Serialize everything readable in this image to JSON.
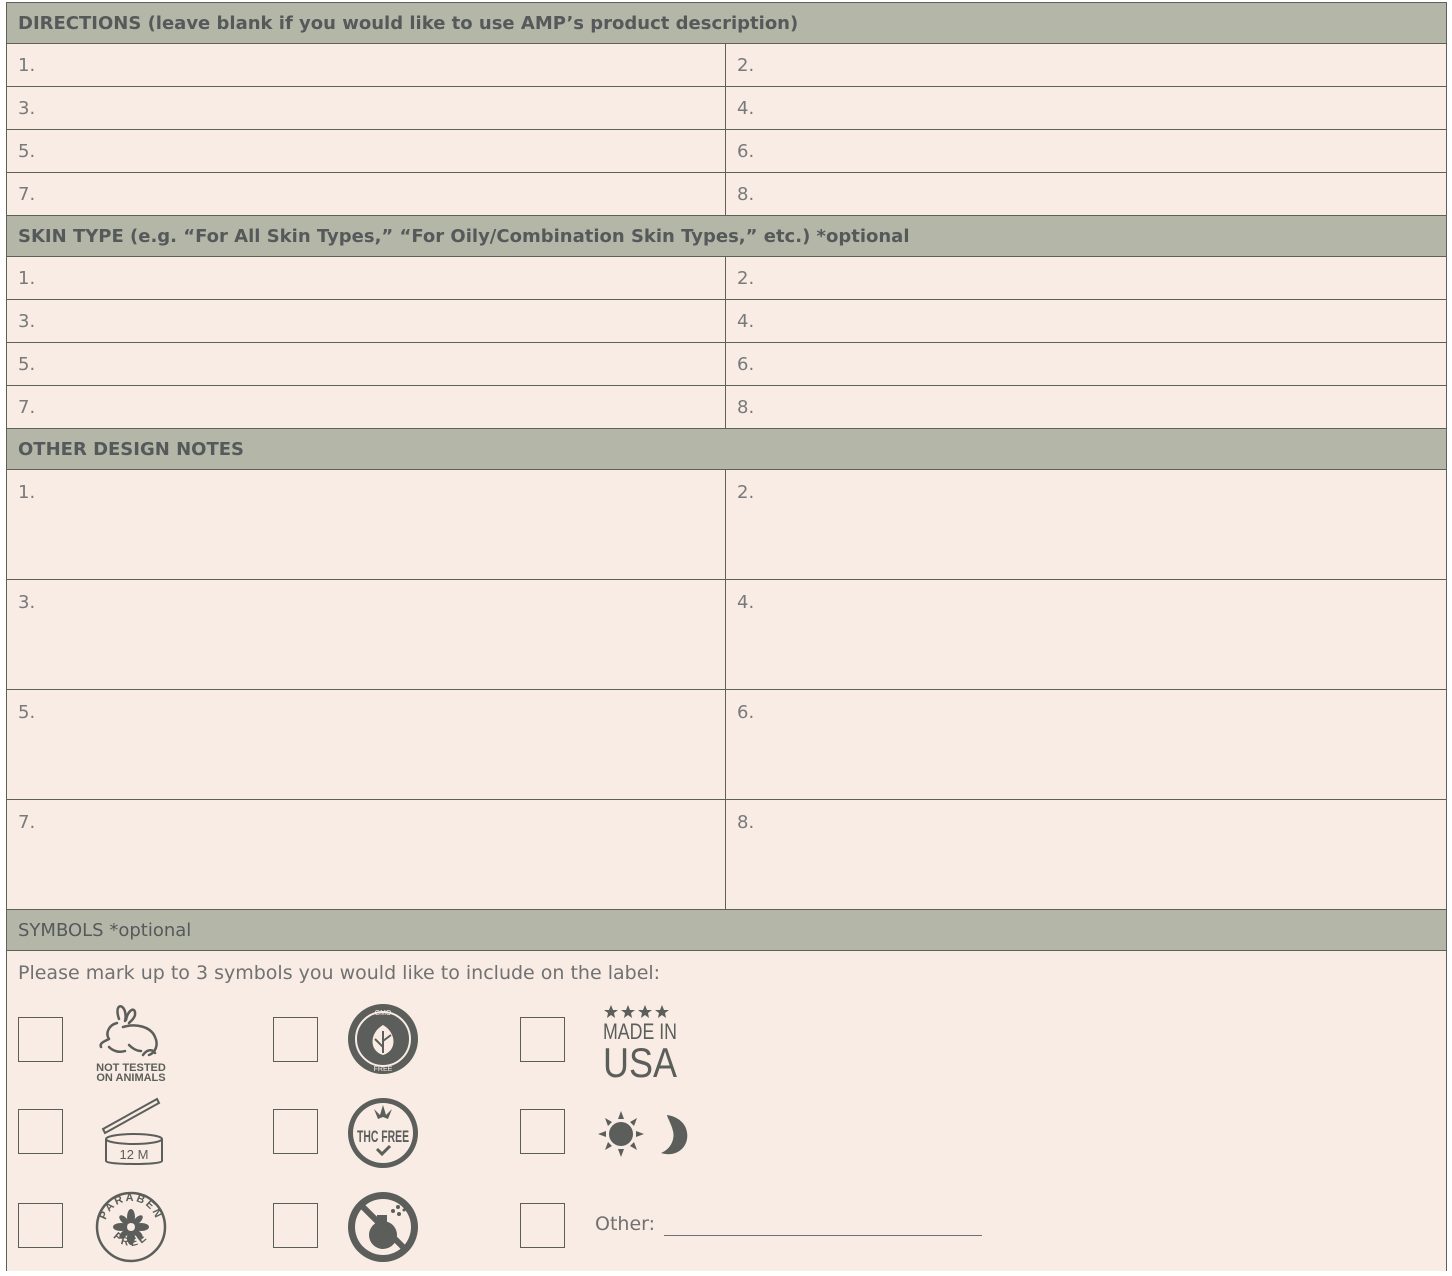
{
  "directions": {
    "header": "DIRECTIONS (leave blank if you would like to use AMP’s product description)",
    "rows": [
      [
        "1.",
        "2."
      ],
      [
        "3.",
        "4."
      ],
      [
        "5.",
        "6."
      ],
      [
        "7.",
        "8."
      ]
    ]
  },
  "skin_type": {
    "header": "SKIN TYPE (e.g. “For All Skin Types,” “For Oily/Combination Skin Types,” etc.) *optional",
    "rows": [
      [
        "1.",
        "2."
      ],
      [
        "3.",
        "4."
      ],
      [
        "5.",
        "6."
      ],
      [
        "7.",
        "8."
      ]
    ]
  },
  "design_notes": {
    "header": "OTHER DESIGN NOTES",
    "rows": [
      [
        "1.",
        "2."
      ],
      [
        "3.",
        "4."
      ],
      [
        "5.",
        "6."
      ],
      [
        "7.",
        "8."
      ]
    ]
  },
  "symbols": {
    "header": "SYMBOLS *optional",
    "prompt": "Please mark up to 3 symbols you would like to include on the label:",
    "not_tested_line1": "NOT TESTED",
    "not_tested_line2": "ON ANIMALS",
    "gmo_top": "GMO",
    "gmo_bottom": "FREE",
    "made_in": "MADE IN",
    "usa": "USA",
    "jar_label": "12 M",
    "thc_free": "THC FREE",
    "paraben_top": "PARABEN",
    "paraben_bottom": "FREE",
    "other_label": "Other:",
    "icon_color": "#5b5e5a"
  }
}
